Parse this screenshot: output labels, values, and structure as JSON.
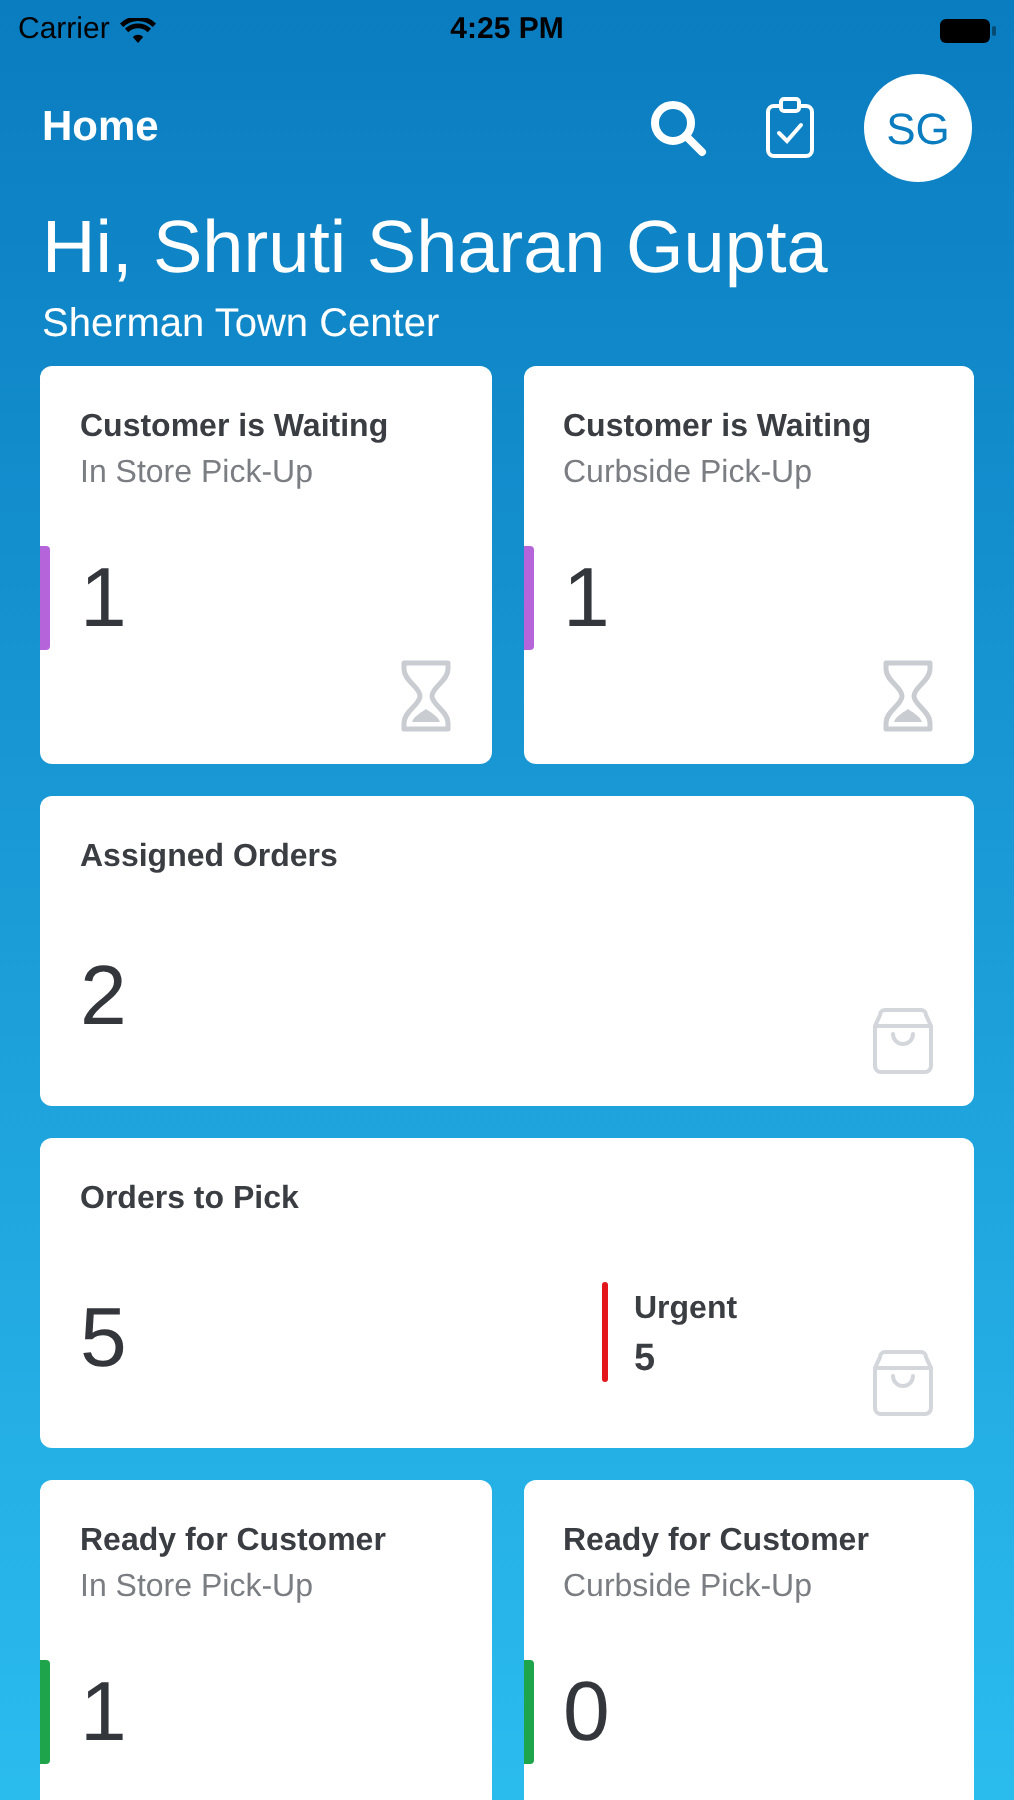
{
  "status_bar": {
    "carrier": "Carrier",
    "time": "4:25 PM"
  },
  "nav": {
    "title": "Home",
    "avatar": "SG"
  },
  "greeting": "Hi, Shruti Sharan Gupta",
  "store": "Sherman Town Center",
  "cards": [
    {
      "kind": "waiting",
      "title": "Customer is Waiting",
      "subtitle": "In Store Pick-Up",
      "count": "1",
      "color": "#b565d9"
    },
    {
      "kind": "waiting",
      "title": "Customer is Waiting",
      "subtitle": "Curbside Pick-Up",
      "count": "1",
      "color": "#b565d9"
    },
    {
      "kind": "orders",
      "title": "Assigned Orders",
      "count": "2"
    },
    {
      "kind": "orders",
      "title": "Orders to Pick",
      "count": "5",
      "urgent": {
        "label": "Urgent",
        "count": "5",
        "color": "#e3161c"
      }
    },
    {
      "kind": "ready",
      "title": "Ready for Customer",
      "subtitle": "In Store Pick-Up",
      "count": "1",
      "color": "#1ea44a"
    },
    {
      "kind": "ready",
      "title": "Ready for Customer",
      "subtitle": "Curbside Pick-Up",
      "count": "0",
      "color": "#1ea44a"
    }
  ]
}
